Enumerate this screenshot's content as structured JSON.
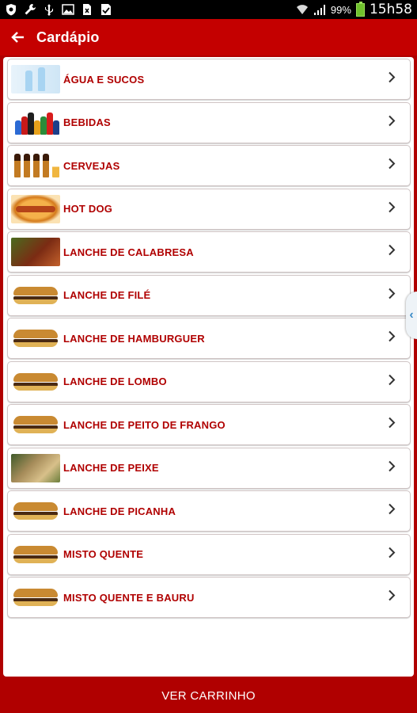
{
  "status_bar": {
    "battery_percent": "99%",
    "time": "15h58",
    "icons_left": [
      "shield-icon",
      "wrench-icon",
      "usb-icon",
      "image-icon",
      "sim-x-icon",
      "check-clipboard-icon"
    ],
    "icons_right": [
      "wifi-icon",
      "signal-icon",
      "battery-icon"
    ]
  },
  "header": {
    "title": "Cardápio",
    "back_icon": "arrow-left-icon"
  },
  "menu": {
    "items": [
      {
        "label": "ÁGUA E SUCOS",
        "thumb": "water"
      },
      {
        "label": "BEBIDAS",
        "thumb": "soda"
      },
      {
        "label": "CERVEJAS",
        "thumb": "beer"
      },
      {
        "label": "HOT DOG",
        "thumb": "hotdog"
      },
      {
        "label": "LANCHE DE CALABRESA",
        "thumb": "calabresa"
      },
      {
        "label": "LANCHE DE FILÉ",
        "thumb": "burger"
      },
      {
        "label": "LANCHE DE HAMBURGUER",
        "thumb": "burger"
      },
      {
        "label": "LANCHE DE LOMBO",
        "thumb": "burger"
      },
      {
        "label": "LANCHE DE PEITO DE FRANGO",
        "thumb": "burger"
      },
      {
        "label": "LANCHE DE PEIXE",
        "thumb": "fish"
      },
      {
        "label": "LANCHE DE PICANHA",
        "thumb": "burger"
      },
      {
        "label": "MISTO QUENTE",
        "thumb": "burger"
      },
      {
        "label": "MISTO QUENTE E BAURU",
        "thumb": "burger"
      }
    ]
  },
  "footer": {
    "cart_button": "VER CARRINHO"
  },
  "colors": {
    "primary": "#c40000",
    "label": "#b00000",
    "side_tab_arrow": "#3b8bc7"
  }
}
